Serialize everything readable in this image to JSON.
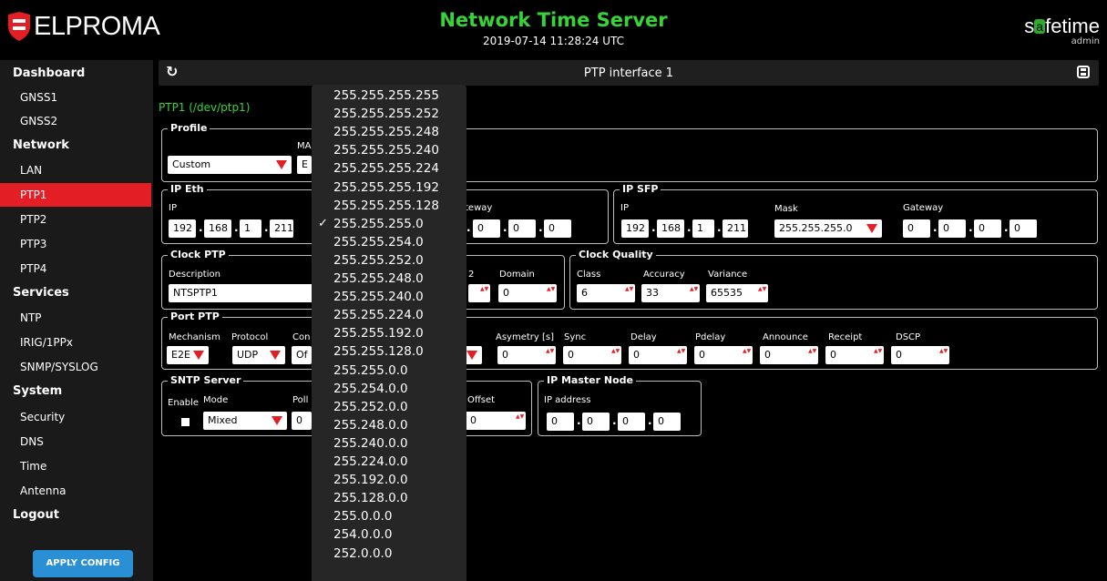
{
  "header": {
    "brand_logo": "ELPROMA",
    "title": "Network Time Server",
    "datetime": "2019-07-14 11:28:24 UTC",
    "brand_product": "safetime",
    "brand_product_pre": "s",
    "brand_product_mark": "a",
    "brand_product_post": "fetime",
    "user": "admin",
    "accent": "#36d436"
  },
  "sidebar": {
    "items": [
      {
        "label": "Dashboard",
        "type": "section"
      },
      {
        "label": "GNSS1",
        "type": "sub"
      },
      {
        "label": "GNSS2",
        "type": "sub"
      },
      {
        "label": "Network",
        "type": "section"
      },
      {
        "label": "LAN",
        "type": "sub"
      },
      {
        "label": "PTP1",
        "type": "sub",
        "active": true
      },
      {
        "label": "PTP2",
        "type": "sub"
      },
      {
        "label": "PTP3",
        "type": "sub"
      },
      {
        "label": "PTP4",
        "type": "sub"
      },
      {
        "label": "Services",
        "type": "section"
      },
      {
        "label": "NTP",
        "type": "sub"
      },
      {
        "label": "IRIG/1PPx",
        "type": "sub"
      },
      {
        "label": "SNMP/SYSLOG",
        "type": "sub"
      },
      {
        "label": "System",
        "type": "section"
      },
      {
        "label": "Security",
        "type": "sub"
      },
      {
        "label": "DNS",
        "type": "sub"
      },
      {
        "label": "Time",
        "type": "sub"
      },
      {
        "label": "Antenna",
        "type": "sub"
      },
      {
        "label": "Logout",
        "type": "section"
      }
    ],
    "apply_label": "APPLY CONFIG"
  },
  "panel": {
    "title": "PTP interface 1",
    "refresh_icon": "refresh-icon",
    "save_icon": "save-icon",
    "device": "PTP1 (/dev/ptp1)"
  },
  "profile": {
    "legend": "Profile",
    "value": "Custom",
    "mac_label": "MA",
    "mac_value": "E"
  },
  "ip_eth": {
    "legend": "IP Eth",
    "ip_label": "IP",
    "ip": [
      "192",
      "168",
      "1",
      "211"
    ],
    "gateway_label": "teway",
    "gateway": [
      "0",
      "0",
      "0"
    ]
  },
  "ip_sfp": {
    "legend": "IP SFP",
    "ip_label": "IP",
    "ip": [
      "192",
      "168",
      "1",
      "211"
    ],
    "mask_label": "Mask",
    "mask": "255.255.255.0",
    "gateway_label": "Gateway",
    "gateway": [
      "0",
      "0",
      "0",
      "0"
    ]
  },
  "clock_ptp": {
    "legend": "Clock PTP",
    "description_label": "Description",
    "description": "NTSPTP1",
    "prio2_label": "2",
    "domain_label": "Domain",
    "domain": "0"
  },
  "clock_quality": {
    "legend": "Clock Quality",
    "class_label": "Class",
    "class": "6",
    "accuracy_label": "Accuracy",
    "accuracy": "33",
    "variance_label": "Variance",
    "variance": "65535"
  },
  "port_ptp": {
    "legend": "Port PTP",
    "mechanism_label": "Mechanism",
    "mechanism": "E2E",
    "protocol_label": "Protocol",
    "protocol": "UDP",
    "con_label": "Con",
    "con_value": "Of",
    "asymetry_label": "Asymetry [s]",
    "asymetry": "0",
    "sync_label": "Sync",
    "sync": "0",
    "delay_label": "Delay",
    "delay": "0",
    "pdelay_label": "Pdelay",
    "pdelay": "0",
    "announce_label": "Announce",
    "announce": "0",
    "receipt_label": "Receipt",
    "receipt": "0",
    "dscp_label": "DSCP",
    "dscp": "0"
  },
  "sntp": {
    "legend": "SNTP Server",
    "enable_label": "Enable",
    "mode_label": "Mode",
    "mode": "Mixed",
    "poll_label": "Poll",
    "poll": "0",
    "offset_label": "Offset",
    "offset": "0"
  },
  "ip_master": {
    "legend": "IP Master Node",
    "ip_label": "IP address",
    "ip": [
      "0",
      "0",
      "0",
      "0"
    ]
  },
  "mask_dropdown": {
    "selected": "255.255.255.0",
    "options": [
      "255.255.255.255",
      "255.255.255.252",
      "255.255.255.248",
      "255.255.255.240",
      "255.255.255.224",
      "255.255.255.192",
      "255.255.255.128",
      "255.255.255.0",
      "255.255.254.0",
      "255.255.252.0",
      "255.255.248.0",
      "255.255.240.0",
      "255.255.224.0",
      "255.255.192.0",
      "255.255.128.0",
      "255.255.0.0",
      "255.254.0.0",
      "255.252.0.0",
      "255.248.0.0",
      "255.240.0.0",
      "255.224.0.0",
      "255.192.0.0",
      "255.128.0.0",
      "255.0.0.0",
      "254.0.0.0",
      "252.0.0.0"
    ]
  }
}
